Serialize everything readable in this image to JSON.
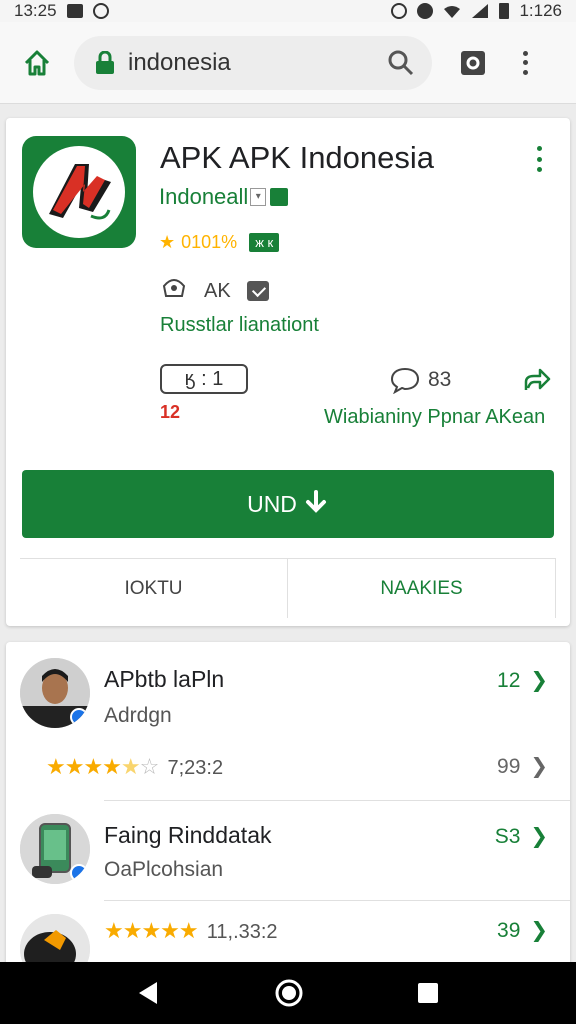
{
  "status_bar": {
    "time": "13:25",
    "right_time": "1:126"
  },
  "browser": {
    "url_text": "indonesia",
    "icons": [
      "home-icon",
      "lock-icon",
      "search-icon",
      "tabs-icon",
      "menu-icon"
    ]
  },
  "app": {
    "title": "APK APK Indonesia",
    "developer": "Indoneall",
    "rating_text": "0101%",
    "rating_badge": "ж к",
    "meta_label": "AK",
    "tagline": "Russtlar lianationt",
    "stat_box": "ӄ : 1",
    "stat_red": "12",
    "comments_count": "83",
    "caption": "Wiabianiny Ppnar AKean",
    "install_label": "UND",
    "tab_left": "IOKTU",
    "tab_right": "NAAKIES",
    "accent_color": "#188038"
  },
  "reviews": [
    {
      "name": "APbtb laPln",
      "subtitle": "Adrdgn",
      "count": "12",
      "stars_text": "7;23:2",
      "stars_count": "99"
    },
    {
      "name": "Faing Rinddatak",
      "subtitle": "OaPlcohsian",
      "count": "S3"
    },
    {
      "stars_text": "11,.33:2",
      "count": "39"
    }
  ]
}
